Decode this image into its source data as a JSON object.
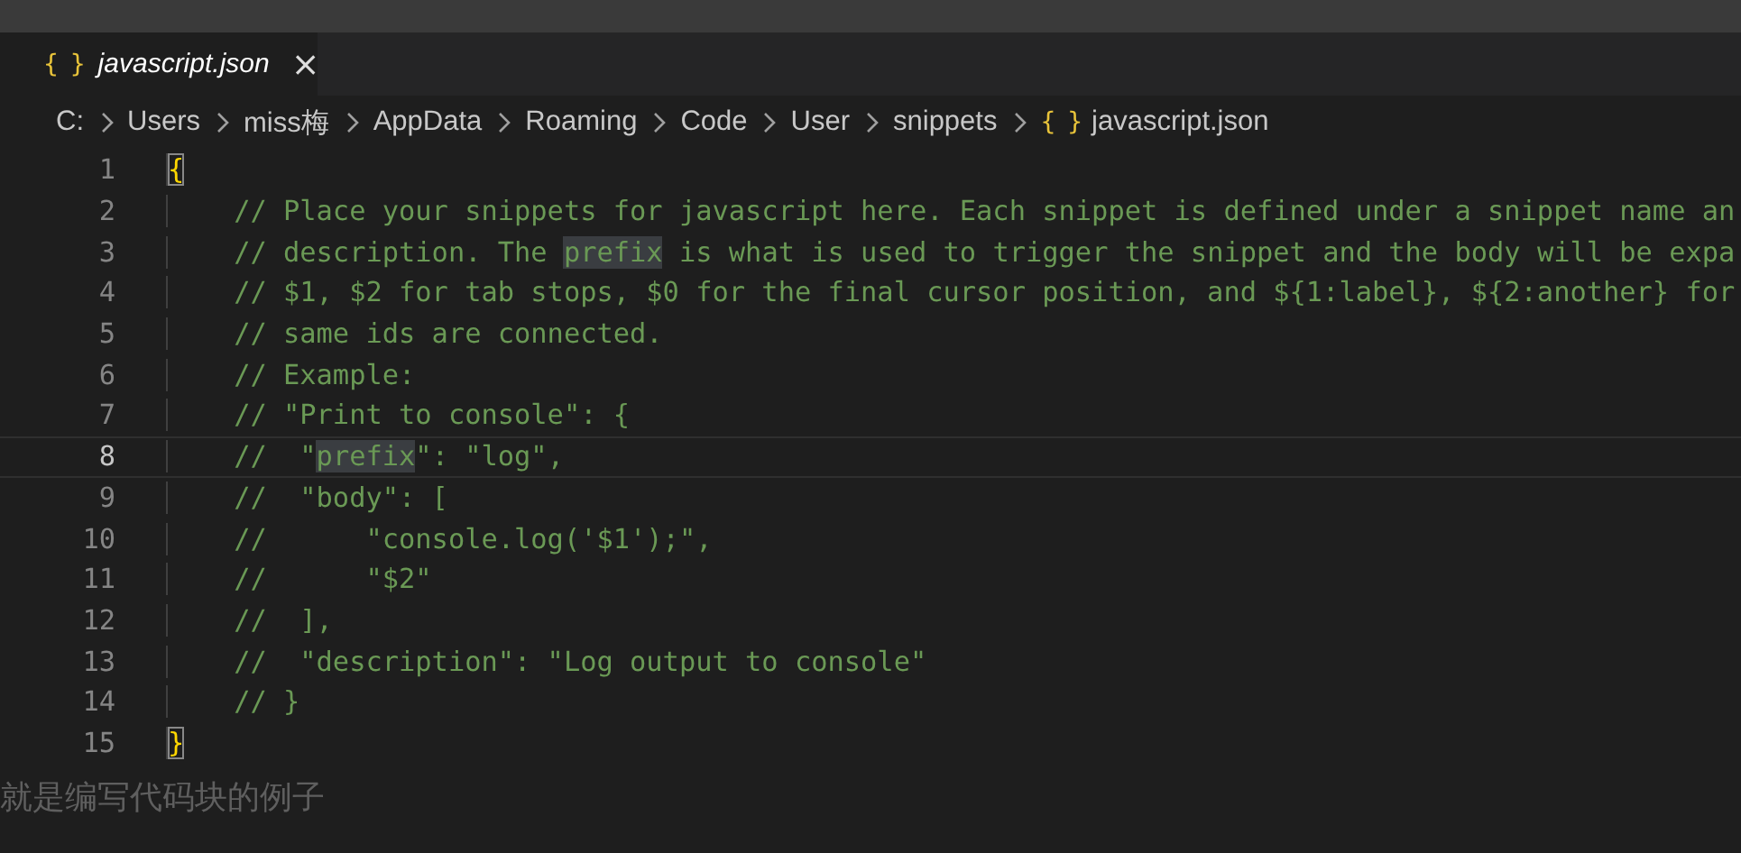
{
  "tab": {
    "icon": "{ }",
    "label": "javascript.json",
    "preview": true,
    "close": "×"
  },
  "breadcrumb": [
    {
      "label": "C:"
    },
    {
      "label": "Users"
    },
    {
      "label": "miss梅"
    },
    {
      "label": "AppData"
    },
    {
      "label": "Roaming"
    },
    {
      "label": "Code"
    },
    {
      "label": "User"
    },
    {
      "label": "snippets"
    },
    {
      "label": "javascript.json",
      "icon": "{ }"
    }
  ],
  "lines": [
    {
      "number": "1",
      "current": false,
      "segments": [
        {
          "text": "{",
          "kind": "bracket"
        }
      ]
    },
    {
      "number": "2",
      "current": false,
      "segments": [
        {
          "text": "    // Place your snippets for javascript here. Each snippet is defined under a snippet name an",
          "kind": "comment"
        }
      ]
    },
    {
      "number": "3",
      "current": false,
      "segments": [
        {
          "text": "    // description. The ",
          "kind": "comment"
        },
        {
          "text": "prefix",
          "kind": "match"
        },
        {
          "text": " is what is used to trigger the snippet and the body will be expa",
          "kind": "comment"
        }
      ]
    },
    {
      "number": "4",
      "current": false,
      "segments": [
        {
          "text": "    // $1, $2 for tab stops, $0 for the final cursor position, and ${1:label}, ${2:another} for",
          "kind": "comment"
        }
      ]
    },
    {
      "number": "5",
      "current": false,
      "segments": [
        {
          "text": "    // same ids are connected.",
          "kind": "comment"
        }
      ]
    },
    {
      "number": "6",
      "current": false,
      "segments": [
        {
          "text": "    // Example:",
          "kind": "comment"
        }
      ]
    },
    {
      "number": "7",
      "current": false,
      "segments": [
        {
          "text": "    // \"Print to console\": {",
          "kind": "comment"
        }
      ]
    },
    {
      "number": "8",
      "current": true,
      "segments": [
        {
          "text": "    //  \"",
          "kind": "comment"
        },
        {
          "text": "prefix",
          "kind": "match"
        },
        {
          "text": "\": \"log\",",
          "kind": "comment"
        }
      ]
    },
    {
      "number": "9",
      "current": false,
      "segments": [
        {
          "text": "    //  \"body\": [",
          "kind": "comment"
        }
      ]
    },
    {
      "number": "10",
      "current": false,
      "segments": [
        {
          "text": "    //      \"console.log('$1');\",",
          "kind": "comment"
        }
      ]
    },
    {
      "number": "11",
      "current": false,
      "segments": [
        {
          "text": "    //      \"$2\"",
          "kind": "comment"
        }
      ]
    },
    {
      "number": "12",
      "current": false,
      "segments": [
        {
          "text": "    //  ],",
          "kind": "comment"
        }
      ]
    },
    {
      "number": "13",
      "current": false,
      "segments": [
        {
          "text": "    //  \"description\": \"Log output to console\"",
          "kind": "comment"
        }
      ]
    },
    {
      "number": "14",
      "current": false,
      "segments": [
        {
          "text": "    // }",
          "kind": "comment"
        }
      ]
    },
    {
      "number": "15",
      "current": false,
      "segments": [
        {
          "text": "}",
          "kind": "bracket"
        }
      ]
    }
  ],
  "overlay_caption": "就是编写代码块的例子"
}
